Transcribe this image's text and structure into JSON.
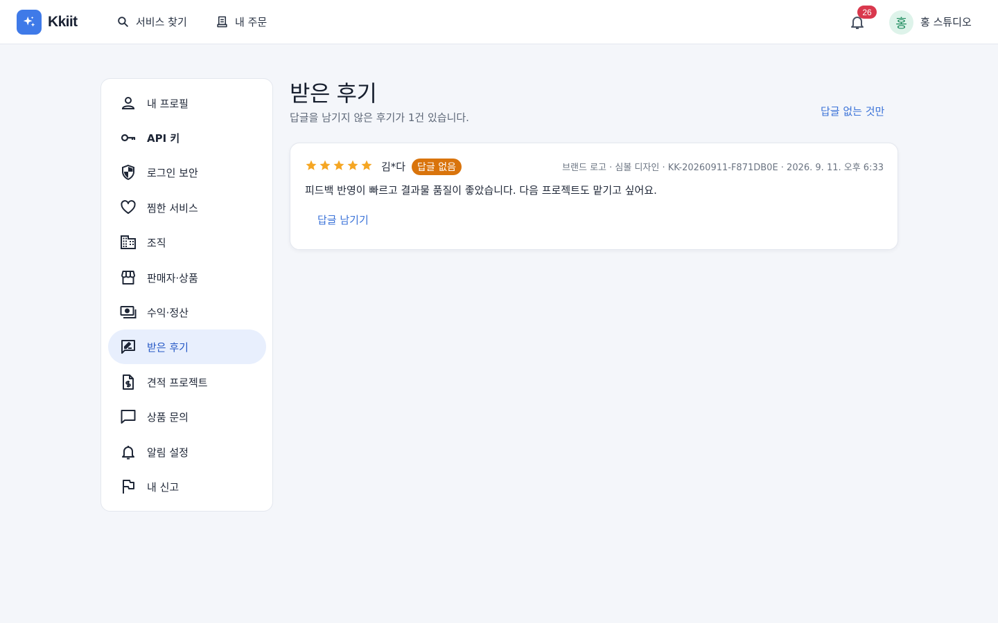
{
  "app": {
    "brand": "Kkiit",
    "colors": {
      "accent": "#3f7ae8",
      "link": "#3a72d8",
      "badge": "#d9384d",
      "status_orange": "#d9740c",
      "star": "#f5a623",
      "active_bg": "#e8effd"
    }
  },
  "topbar": {
    "nav": [
      {
        "label": "서비스 찾기",
        "icon": "search-icon"
      },
      {
        "label": "내 주문",
        "icon": "receipt-icon"
      }
    ],
    "notifications_count": "26",
    "user": {
      "avatar_initial": "홍",
      "name": "홍 스튜디오"
    }
  },
  "sidebar": {
    "items": [
      {
        "label": "내 프로필",
        "icon": "person-icon",
        "bold": false,
        "active": false
      },
      {
        "label": "API 키",
        "icon": "key-icon",
        "bold": true,
        "active": false
      },
      {
        "label": "로그인 보안",
        "icon": "shield-icon",
        "bold": false,
        "active": false
      },
      {
        "label": "찜한 서비스",
        "icon": "heart-icon",
        "bold": false,
        "active": false
      },
      {
        "label": "조직",
        "icon": "building-icon",
        "bold": false,
        "active": false
      },
      {
        "label": "판매자·상품",
        "icon": "storefront-icon",
        "bold": false,
        "active": false
      },
      {
        "label": "수익·정산",
        "icon": "payments-icon",
        "bold": false,
        "active": false
      },
      {
        "label": "받은 후기",
        "icon": "rate-review-icon",
        "bold": false,
        "active": true
      },
      {
        "label": "견적 프로젝트",
        "icon": "invoice-dollar-icon",
        "bold": false,
        "active": false
      },
      {
        "label": "상품 문의",
        "icon": "chat-bubble-icon",
        "bold": false,
        "active": false
      },
      {
        "label": "알림 설정",
        "icon": "bell-icon",
        "bold": false,
        "active": false
      },
      {
        "label": "내 신고",
        "icon": "flag-icon",
        "bold": false,
        "active": false
      }
    ]
  },
  "main": {
    "title": "받은 후기",
    "subtitle": "답글을 남기지 않은 후기가 1건 있습니다.",
    "filter_label": "답글 없는 것만",
    "reviews": [
      {
        "rating": 5,
        "reviewer": "김*다",
        "status": "답글 없음",
        "meta": "브랜드 로고 · 심볼 디자인 · KK-20260911-F871DB0E · 2026. 9. 11. 오후 6:33",
        "text": "피드백 반영이 빠르고 결과물 품질이 좋았습니다. 다음 프로젝트도 맡기고 싶어요.",
        "reply_label": "답글 남기기"
      }
    ]
  }
}
